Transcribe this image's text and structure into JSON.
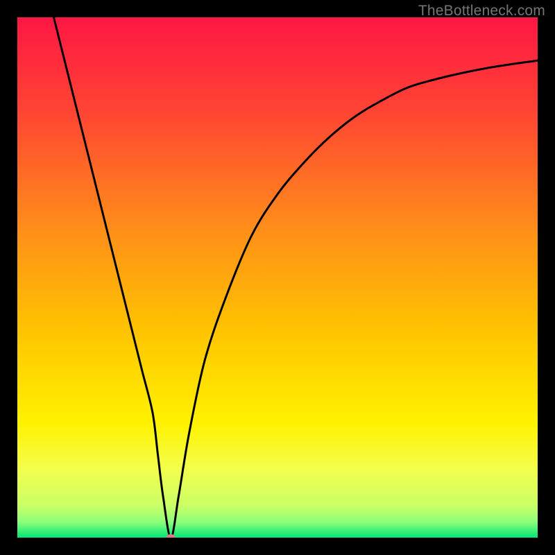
{
  "watermark": "TheBottleneck.com",
  "chart_data": {
    "type": "line",
    "title": "",
    "xlabel": "",
    "ylabel": "",
    "xlim": [
      0,
      100
    ],
    "ylim": [
      0,
      100
    ],
    "gradient_stops": [
      {
        "offset": 0.0,
        "color": "#ff1744"
      },
      {
        "offset": 0.18,
        "color": "#ff4433"
      },
      {
        "offset": 0.4,
        "color": "#ff8c1a"
      },
      {
        "offset": 0.6,
        "color": "#ffc300"
      },
      {
        "offset": 0.78,
        "color": "#fff200"
      },
      {
        "offset": 0.87,
        "color": "#f2ff4d"
      },
      {
        "offset": 0.94,
        "color": "#c8ff66"
      },
      {
        "offset": 0.97,
        "color": "#8dff7a"
      },
      {
        "offset": 1.0,
        "color": "#00e676"
      }
    ],
    "series": [
      {
        "name": "curve",
        "x": [
          7,
          10,
          14,
          18,
          22,
          24,
          26,
          27,
          28,
          29.5,
          31,
          33,
          36,
          40,
          45,
          50,
          55,
          60,
          65,
          70,
          75,
          80,
          85,
          90,
          95,
          100
        ],
        "y": [
          100,
          88,
          72,
          56,
          40,
          32,
          24,
          16,
          8,
          0,
          8,
          20,
          34,
          46,
          58,
          66,
          72,
          77,
          81,
          84,
          86.5,
          88,
          89.2,
          90.2,
          91,
          91.7
        ]
      }
    ],
    "marker": {
      "x": 29.5,
      "y": 0,
      "rx": 7,
      "ry": 5,
      "color": "#d08080"
    }
  }
}
